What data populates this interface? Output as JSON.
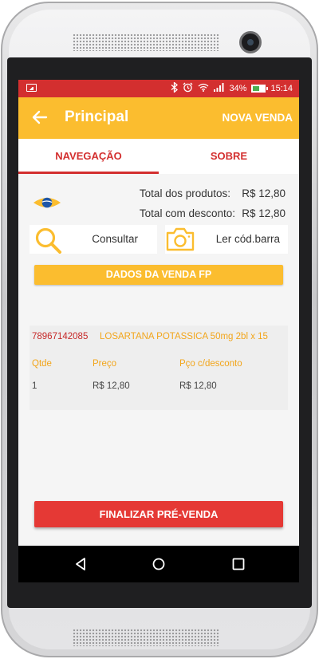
{
  "status_bar": {
    "battery": "34%",
    "time": "15:14",
    "icons": [
      "image-icon",
      "bluetooth-icon",
      "alarm-icon",
      "wifi-icon",
      "signal-icon",
      "battery-icon"
    ]
  },
  "app_bar": {
    "title": "Principal",
    "action": "NOVA VENDA",
    "color": "#fbbd2f"
  },
  "tabs": [
    {
      "label": "NAVEGAÇÃO",
      "selected": true
    },
    {
      "label": "SOBRE",
      "selected": false
    }
  ],
  "totals": {
    "produtos_label": "Total dos produtos:",
    "produtos_value": "R$ 12,80",
    "desconto_label": "Total com desconto:",
    "desconto_value": "R$ 12,80"
  },
  "actions": {
    "consultar": "Consultar",
    "ler_codigo": "Ler cód.barra"
  },
  "buttons": {
    "dados_venda": "DADOS DA VENDA FP",
    "finalizar": "FINALIZAR PRÉ-VENDA"
  },
  "item": {
    "code": "78967142085",
    "description": "LOSARTANA POTASSICA 50mg 2bl x 15",
    "headers": {
      "qtde": "Qtde",
      "preco": "Preço",
      "preco_desconto": "Pço c/desconto"
    },
    "values": {
      "qtde": "1",
      "preco": "R$ 12,80",
      "preco_desconto": "R$ 12,80"
    }
  },
  "colors": {
    "status_bar": "#d32f2f",
    "accent_red": "#e53935",
    "accent_yellow": "#fbbd2f"
  }
}
